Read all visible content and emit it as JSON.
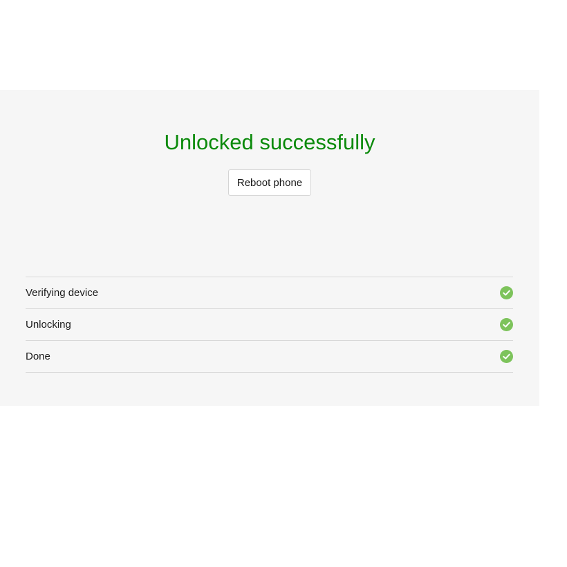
{
  "result": {
    "title": "Unlocked successfully",
    "reboot_label": "Reboot phone"
  },
  "steps": [
    {
      "label": "Verifying device",
      "status": "complete",
      "icon": "check-circle-icon"
    },
    {
      "label": "Unlocking",
      "status": "complete",
      "icon": "check-circle-icon"
    },
    {
      "label": "Done",
      "status": "complete",
      "icon": "check-circle-icon"
    }
  ],
  "colors": {
    "title": "#0b8a0b",
    "check": "#7dc35b",
    "panel_bg": "#f6f6f6"
  }
}
